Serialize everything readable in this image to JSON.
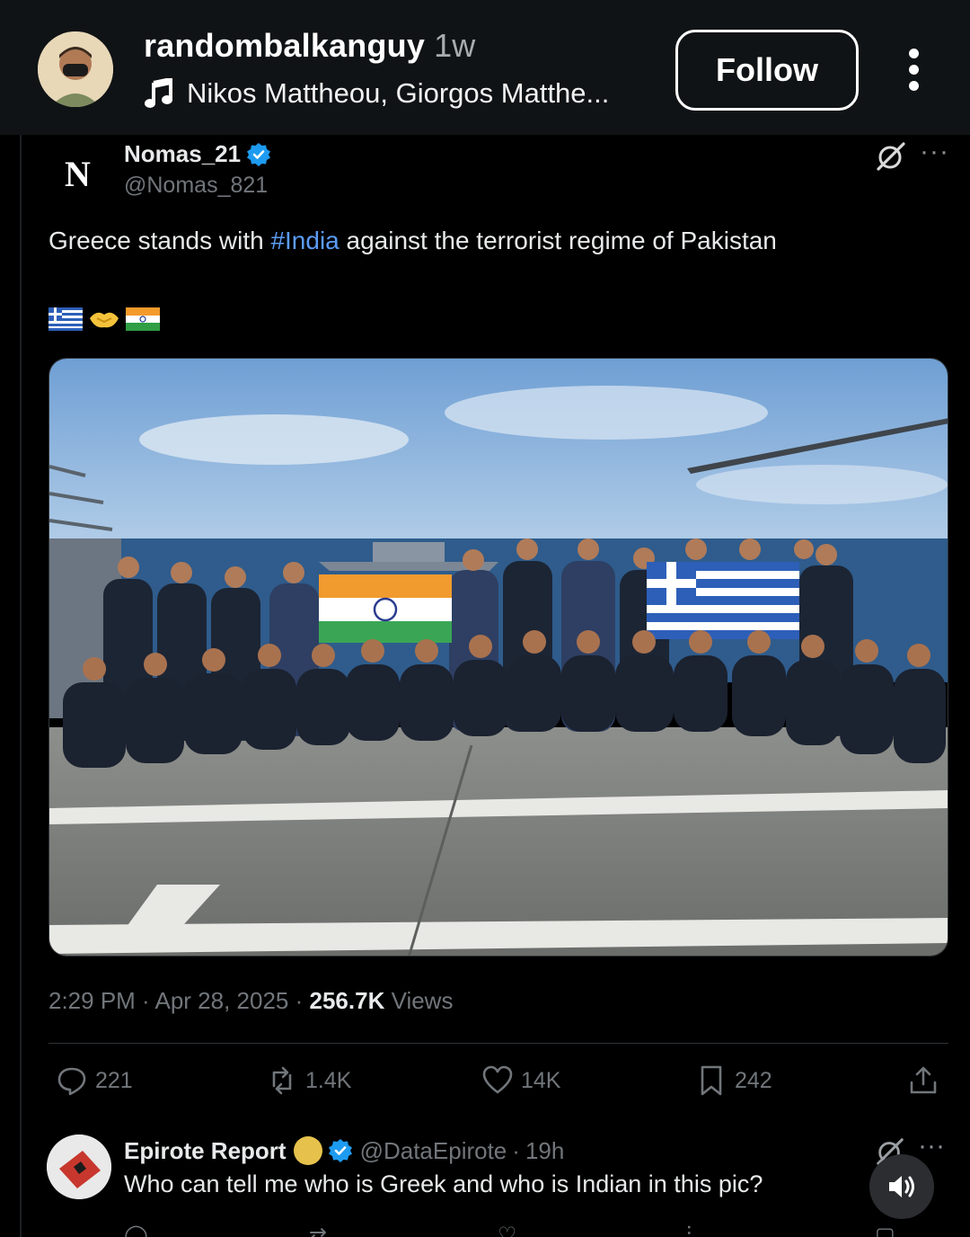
{
  "reel": {
    "username": "randombalkanguy",
    "posted_ago": "1w",
    "music": "Nikos Mattheou, Giorgos Matthe...",
    "follow_label": "Follow"
  },
  "tweet": {
    "logo_letter": "N",
    "author_name": "Nomas_21",
    "author_handle": "@Nomas_821",
    "text_before": "Greece stands with ",
    "hashtag": "#India",
    "text_after": " against the terrorist regime of Pakistan",
    "emojis": [
      "greek-flag",
      "handshake",
      "indian-flag"
    ],
    "time": "2:29 PM",
    "date": "Apr 28, 2025",
    "views_count": "256.7K",
    "views_label": "Views",
    "stats": {
      "replies": "221",
      "reposts": "1.4K",
      "likes": "14K",
      "bookmarks": "242"
    }
  },
  "reply": {
    "name": "Epirote Report",
    "handle": "@DataEpirote",
    "age": "19h",
    "text": "Who can tell me who is Greek and who is Indian in this pic?"
  },
  "colors": {
    "header_bg": "#101315",
    "link_blue": "#5b9cf5",
    "verified_blue": "#1d9bf0",
    "muted": "#71767b"
  }
}
